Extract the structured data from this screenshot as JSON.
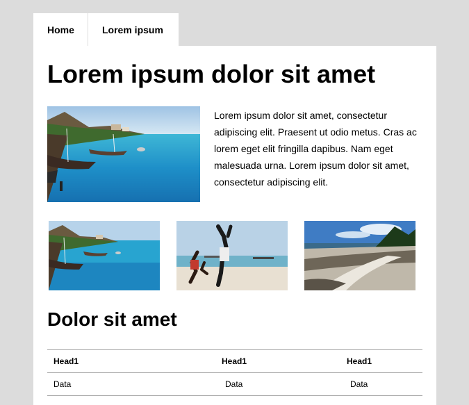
{
  "tabs": [
    {
      "label": "Home"
    },
    {
      "label": "Lorem ipsum"
    }
  ],
  "main": {
    "title": "Lorem ipsum dolor sit amet",
    "intro": "Lorem ipsum dolor sit amet, consectetur adipiscing elit. Praesent ut odio metus. Cras ac lorem eget elit fringilla dapibus. Nam eget malesuada urna. Lorem ipsum dolor sit amet, consectetur adipiscing elit.",
    "subtitle": "Dolor sit amet"
  },
  "table": {
    "headers": [
      "Head1",
      "Head1",
      "Head1"
    ],
    "rows": [
      [
        "Data",
        "Data",
        "Data"
      ]
    ]
  },
  "colors": {
    "page_background": "#dcdcdc",
    "panel_background": "#ffffff",
    "table_border": "#aaaaaa"
  }
}
